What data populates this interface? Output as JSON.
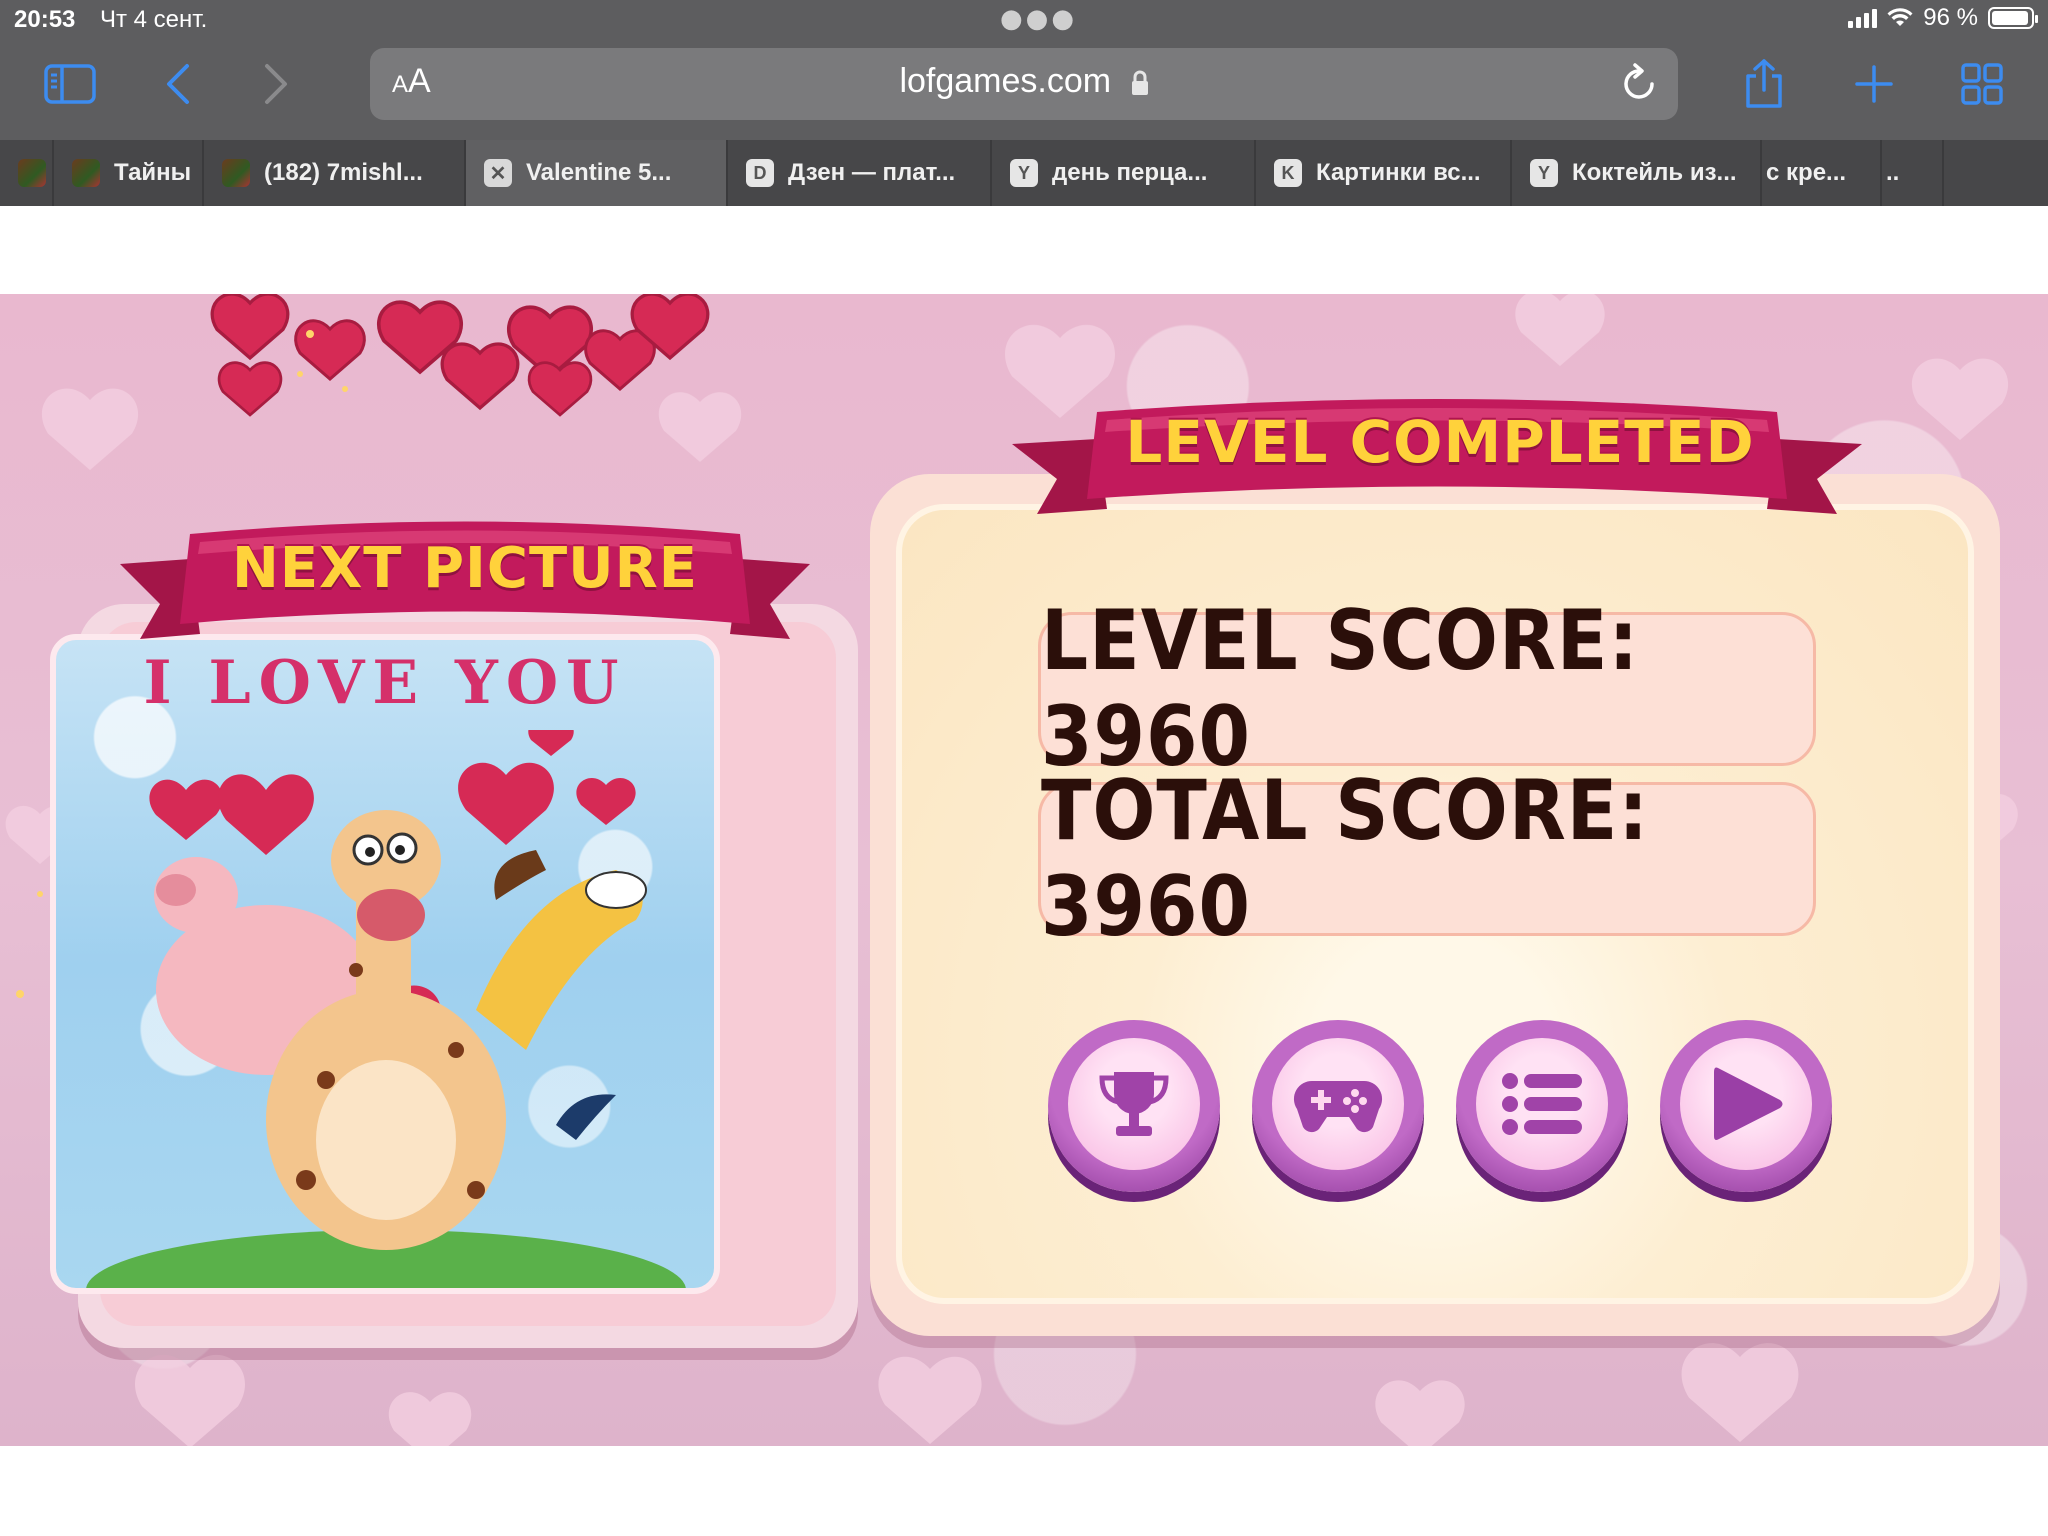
{
  "status_bar": {
    "time": "20:53",
    "date": "Чт 4 сент.",
    "battery_pct": "96 %",
    "battery_level": 0.96
  },
  "url_bar": {
    "aa_label_big": "A",
    "aa_label_small": "A",
    "domain": "lofgames.com"
  },
  "tabs": [
    {
      "label": "",
      "favicon": "picture",
      "width": 54
    },
    {
      "label": "Тайны",
      "favicon": "picture",
      "width": 150
    },
    {
      "label": "(182) 7mishl...",
      "favicon": "picture",
      "width": 262
    },
    {
      "label": "Valentine 5...",
      "favicon": "close",
      "favicon_char": "✕",
      "width": 262,
      "active": true
    },
    {
      "label": "Дзен — плат...",
      "favicon": "letter",
      "favicon_char": "D",
      "width": 264
    },
    {
      "label": "день перца...",
      "favicon": "letter",
      "favicon_char": "Y",
      "width": 264
    },
    {
      "label": "Картинки вс...",
      "favicon": "letter",
      "favicon_char": "K",
      "width": 256
    },
    {
      "label": "Коктейль из...",
      "favicon": "letter",
      "favicon_char": "Y",
      "width": 250
    },
    {
      "label": "с кре...",
      "favicon": "none",
      "width": 120
    },
    {
      "label": "..",
      "favicon": "none",
      "width": 62
    }
  ],
  "game": {
    "next_picture_title": "NEXT PICTURE",
    "picture_caption": "I LOVE YOU",
    "level_completed_title": "LEVEL COMPLETED",
    "level_score_label": "LEVEL SCORE: 3960",
    "total_score_label": "TOTAL SCORE: 3960",
    "buttons": [
      {
        "name": "trophy",
        "icon": "trophy-icon"
      },
      {
        "name": "games",
        "icon": "gamepad-icon"
      },
      {
        "name": "levels",
        "icon": "list-icon"
      },
      {
        "name": "play",
        "icon": "play-icon"
      }
    ]
  },
  "colors": {
    "chrome_bg": "#5d5d5f",
    "accent_blue": "#3d8cf0",
    "ribbon": "#c21a5c",
    "ribbon_text": "#ffd23b",
    "button_purple": "#9a3fa6"
  }
}
